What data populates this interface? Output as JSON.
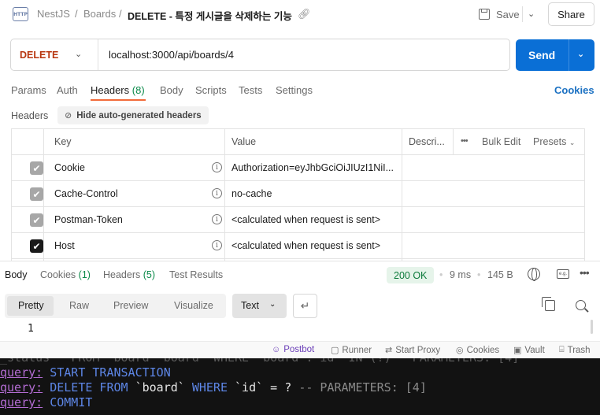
{
  "breadcrumb": {
    "icon_text": "HTTP",
    "items": [
      "NestJS",
      "Boards"
    ],
    "separator": "/",
    "title": "DELETE - 특정 게시글을 삭제하는 기능"
  },
  "toolbar": {
    "save_label": "Save",
    "share_label": "Share"
  },
  "request": {
    "method": "DELETE",
    "method_color": "#b8360f",
    "url": "localhost:3000/api/boards/4",
    "send_label": "Send",
    "send_color": "#0a6fd6"
  },
  "request_tabs": [
    {
      "label": "Params"
    },
    {
      "label": "Auth"
    },
    {
      "label": "Headers",
      "count": "(8)",
      "active": true
    },
    {
      "label": "Body"
    },
    {
      "label": "Scripts"
    },
    {
      "label": "Tests"
    },
    {
      "label": "Settings"
    }
  ],
  "cookies_link": "Cookies",
  "headers_section": {
    "label": "Headers",
    "hide_auto_label": "Hide auto-generated headers"
  },
  "headers_table": {
    "columns": [
      "Key",
      "Value",
      "Descri..."
    ],
    "bulk_edit": "Bulk Edit",
    "presets": "Presets",
    "rows": [
      {
        "key": "Cookie",
        "value": "Authorization=eyJhbGciOiJIUzI1NiI...",
        "checked": true,
        "muted": true
      },
      {
        "key": "Cache-Control",
        "value": "no-cache",
        "checked": true,
        "muted": true
      },
      {
        "key": "Postman-Token",
        "value": "<calculated when request is sent>",
        "checked": true,
        "muted": true
      },
      {
        "key": "Host",
        "value": "<calculated when request is sent>",
        "checked": true,
        "muted": false
      }
    ]
  },
  "response_tabs": [
    {
      "label": "Body",
      "active": true
    },
    {
      "label": "Cookies",
      "count": "(1)"
    },
    {
      "label": "Headers",
      "count": "(5)"
    },
    {
      "label": "Test Results"
    }
  ],
  "response_meta": {
    "status": "200 OK",
    "time": "9 ms",
    "size": "145 B"
  },
  "body_formats": [
    "Pretty",
    "Raw",
    "Preview",
    "Visualize"
  ],
  "body_type": "Text",
  "body_lines": [
    "1"
  ],
  "status_bar": [
    {
      "label": "Postbot",
      "icon": "postbot-icon"
    },
    {
      "label": "Runner",
      "icon": "runner-icon"
    },
    {
      "label": "Start Proxy",
      "icon": "proxy-icon"
    },
    {
      "label": "Cookies",
      "icon": "cookie-icon"
    },
    {
      "label": "Vault",
      "icon": "vault-icon"
    },
    {
      "label": "Trash",
      "icon": "trash-icon"
    }
  ],
  "terminal": {
    "partial_line": "_status   FROM  board  board  WHERE  board . id  IN (?)   PARAMETERS: [4]",
    "lines": [
      {
        "prefix": "query:",
        "text": " START TRANSACTION"
      },
      {
        "prefix": "query:",
        "kw1": " DELETE FROM ",
        "mid1": "`board` ",
        "kw2": "WHERE ",
        "mid2": "`id` = ? ",
        "dim": "-- PARAMETERS: [4]"
      },
      {
        "prefix": "query:",
        "text": " COMMIT"
      }
    ]
  }
}
